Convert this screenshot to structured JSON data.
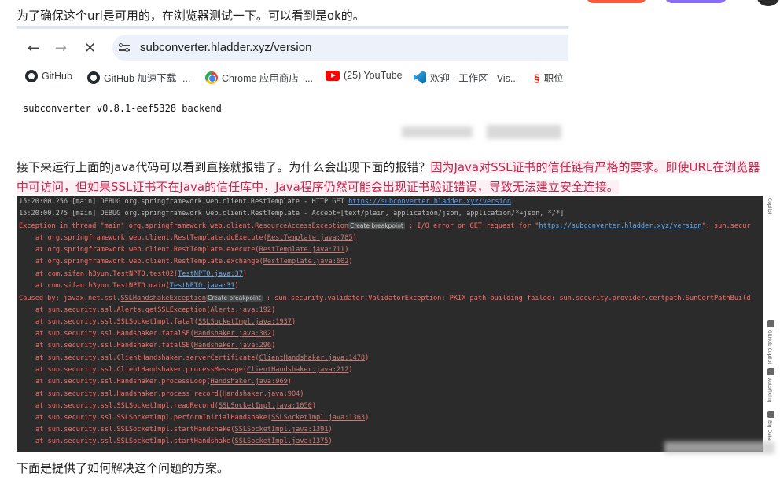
{
  "top_text": "为了确保这个url是可用的，在浏览器测试一下。可以看到是ok的。",
  "browser": {
    "url": "subconverter.hladder.xyz/version",
    "bookmarks": [
      {
        "label": "GitHub"
      },
      {
        "label": "GitHub 加速下载 -..."
      },
      {
        "label": "Chrome 应用商店 -..."
      },
      {
        "label": "(25) YouTube"
      },
      {
        "label": "欢迎 - 工作区 - Vis..."
      },
      {
        "label": "职位"
      }
    ],
    "body_text": "subconverter v0.8.1-eef5328 backend"
  },
  "explain": {
    "plain": "接下来运行上面的java代码可以看到直接就报错了。为什么会出现下面的报错？",
    "highlight": "因为Java对SSL证书的信任链有严格的要求。即使URL在浏览器中可访问，但如果SSL证书不在Java的信任库中，Java程序仍然可能会出现证书验证错误，导致无法建立安全连接。"
  },
  "console": {
    "log1": "15:20:00.256 [main] DEBUG org.springframework.web.client.RestTemplate - HTTP GET ",
    "log1_link": "https://subconverter.hladder.xyz/version",
    "log2": "15:20:00.275 [main] DEBUG org.springframework.web.client.RestTemplate - Accept=[text/plain, application/json, application/*+json, */*]",
    "exc_prefix": "Exception in thread \"main\" org.springframework.web.client.",
    "exc_class": "ResourceAccessException",
    "exc_hint": "Create breakpoint",
    "exc_msg": " : I/O error on GET request for \"",
    "exc_link": "https://subconverter.hladder.xyz/version",
    "exc_tail": "\": sun.secur",
    "stack1": [
      {
        "call": "at org.springframework.web.client.RestTemplate.doExecute(",
        "loc": "RestTemplate.java:785",
        "end": ")"
      },
      {
        "call": "at org.springframework.web.client.RestTemplate.execute(",
        "loc": "RestTemplate.java:711",
        "end": ")"
      },
      {
        "call": "at org.springframework.web.client.RestTemplate.exchange(",
        "loc": "RestTemplate.java:602",
        "end": ")"
      },
      {
        "call": "at com.sifan.h3yun.TestNPTO.test02(",
        "loc": "TestNPTO.java:37",
        "end": ")"
      },
      {
        "call": "at com.sifan.h3yun.TestNPTO.main(",
        "loc": "TestNPTO.java:31",
        "end": ")"
      }
    ],
    "caused_prefix": "Caused by: javax.net.ssl.",
    "caused_class": "SSLHandshakeException",
    "caused_hint": "Create breakpoint",
    "caused_msg": " : sun.security.validator.ValidatorException: PKIX path building failed: sun.security.provider.certpath.SunCertPathBuild",
    "stack2": [
      {
        "call": "at sun.security.ssl.Alerts.getSSLException(",
        "loc": "Alerts.java:192",
        "end": ")"
      },
      {
        "call": "at sun.security.ssl.SSLSocketImpl.fatal(",
        "loc": "SSLSocketImpl.java:1937",
        "end": ")"
      },
      {
        "call": "at sun.security.ssl.Handshaker.fatalSE(",
        "loc": "Handshaker.java:302",
        "end": ")"
      },
      {
        "call": "at sun.security.ssl.Handshaker.fatalSE(",
        "loc": "Handshaker.java:296",
        "end": ")"
      },
      {
        "call": "at sun.security.ssl.ClientHandshaker.serverCertificate(",
        "loc": "ClientHandshaker.java:1478",
        "end": ")"
      },
      {
        "call": "at sun.security.ssl.ClientHandshaker.processMessage(",
        "loc": "ClientHandshaker.java:212",
        "end": ")"
      },
      {
        "call": "at sun.security.ssl.Handshaker.processLoop(",
        "loc": "Handshaker.java:969",
        "end": ")"
      },
      {
        "call": "at sun.security.ssl.Handshaker.process_record(",
        "loc": "Handshaker.java:904",
        "end": ")"
      },
      {
        "call": "at sun.security.ssl.SSLSocketImpl.readRecord(",
        "loc": "SSLSocketImpl.java:1050",
        "end": ")"
      },
      {
        "call": "at sun.security.ssl.SSLSocketImpl.performInitialHandshake(",
        "loc": "SSLSocketImpl.java:1363",
        "end": ")"
      },
      {
        "call": "at sun.security.ssl.SSLSocketImpl.startHandshake(",
        "loc": "SSLSocketImpl.java:1391",
        "end": ")"
      },
      {
        "call": "at sun.security.ssl.SSLSocketImpl.startHandshake(",
        "loc": "SSLSocketImpl.java:1375",
        "end": ")"
      }
    ],
    "side_labels": [
      "Copilot",
      "GitHub Copilot",
      "AutoFixing",
      "Big Data"
    ]
  },
  "bottom_text": "下面是提供了如何解决这个问题的方案。",
  "colors": {
    "error": "#ff6b68",
    "link": "#589df6",
    "highlight": "#c7254e",
    "console_bg": "#2b2b2b"
  }
}
